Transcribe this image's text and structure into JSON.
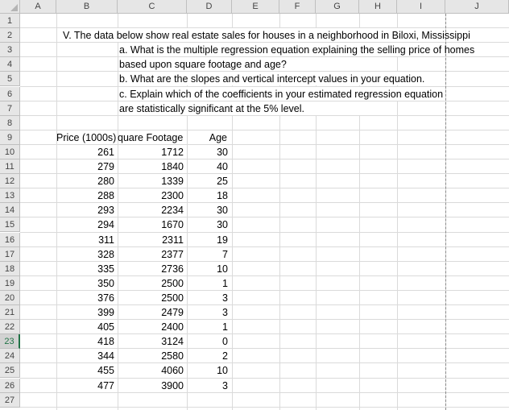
{
  "columns": [
    "A",
    "B",
    "C",
    "D",
    "E",
    "F",
    "G",
    "H",
    "I",
    "J"
  ],
  "rows": [
    "1",
    "2",
    "3",
    "4",
    "5",
    "6",
    "7",
    "8",
    "9",
    "10",
    "11",
    "12",
    "13",
    "14",
    "15",
    "16",
    "17",
    "18",
    "19",
    "20",
    "21",
    "22",
    "23",
    "24",
    "25",
    "26",
    "27"
  ],
  "selected_row": "23",
  "text": {
    "intro": "V. The data below show real estate sales for houses in a neighborhood in Biloxi, Mississippi",
    "qa1": "a.  What is the multiple regression equation explaining the selling price of homes",
    "qa2": "based upon square footage and age?",
    "qb": "b.  What are the slopes and vertical intercept values in your equation.",
    "qc1": "c. Explain which of the coefficients in your estimated regression equation",
    "qc2": "are statistically significant at the 5% level."
  },
  "table": {
    "headers": [
      "Price (1000s)",
      "quare Footage",
      "Age"
    ],
    "rows": [
      [
        "261",
        "1712",
        "30"
      ],
      [
        "279",
        "1840",
        "40"
      ],
      [
        "280",
        "1339",
        "25"
      ],
      [
        "288",
        "2300",
        "18"
      ],
      [
        "293",
        "2234",
        "30"
      ],
      [
        "294",
        "1670",
        "30"
      ],
      [
        "311",
        "2311",
        "19"
      ],
      [
        "328",
        "2377",
        "7"
      ],
      [
        "335",
        "2736",
        "10"
      ],
      [
        "350",
        "2500",
        "1"
      ],
      [
        "376",
        "2500",
        "3"
      ],
      [
        "399",
        "2479",
        "3"
      ],
      [
        "405",
        "2400",
        "1"
      ],
      [
        "418",
        "3124",
        "0"
      ],
      [
        "344",
        "2580",
        "2"
      ],
      [
        "455",
        "4060",
        "10"
      ],
      [
        "477",
        "3900",
        "3"
      ]
    ]
  }
}
